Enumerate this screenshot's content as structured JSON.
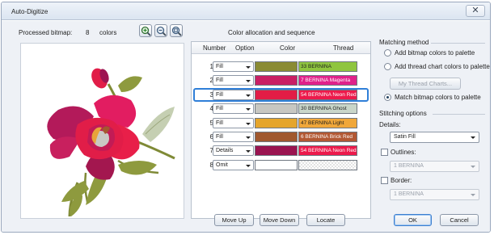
{
  "window": {
    "title": "Auto-Digitize",
    "close_glyph": "✕"
  },
  "bitmap": {
    "label": "Processed bitmap:",
    "count": "8",
    "unit": "colors"
  },
  "zoom_icons": [
    "zoom-in-icon",
    "zoom-out-icon",
    "zoom-fit-icon"
  ],
  "allocation": {
    "title": "Color allocation and sequence",
    "headers": {
      "number": "Number",
      "option": "Option",
      "color": "Color",
      "thread": "Thread"
    },
    "rows": [
      {
        "number": "1",
        "option": "Fill",
        "color": "#8a8b34",
        "thread": "33 BERNINA",
        "thread_color": "#8fc53f",
        "thread_text": "#1e1e1e"
      },
      {
        "number": "2",
        "option": "Fill",
        "color": "#c91f64",
        "thread": "7 BERNINA Magenta",
        "thread_color": "#e0218a",
        "thread_text": "#ffffff"
      },
      {
        "number": "3",
        "option": "Fill",
        "color": "#e21d46",
        "thread": "54 BERNINA Neon Red",
        "thread_color": "#ec1a4b",
        "thread_text": "#ffffff",
        "selected": true
      },
      {
        "number": "4",
        "option": "Fill",
        "color": "#c7c7c2",
        "thread": "30 BERNINA Ghost",
        "thread_color": "#c9d6c9",
        "thread_text": "#1e1e1e"
      },
      {
        "number": "5",
        "option": "Fill",
        "color": "#e5a52b",
        "thread": "47 BERNINA Light",
        "thread_color": "#f0a73a",
        "thread_text": "#1e1e1e"
      },
      {
        "number": "6",
        "option": "Fill",
        "color": "#a0582e",
        "thread": "6 BERNINA Brick Red",
        "thread_color": "#b25833",
        "thread_text": "#ffffff"
      },
      {
        "number": "7",
        "option": "Details",
        "color": "#9a1450",
        "thread": "54 BERNINA Neon Red",
        "thread_color": "#ec1a4b",
        "thread_text": "#ffffff"
      },
      {
        "number": "8",
        "option": "Omit",
        "color": "#ffffff",
        "thread": "",
        "thread_color": "",
        "thread_text": "#1e1e1e",
        "empty": true
      }
    ]
  },
  "matching": {
    "title": "Matching method",
    "options": [
      {
        "label": "Add bitmap colors to palette",
        "checked": false
      },
      {
        "label": "Add thread chart colors to palette",
        "checked": false
      },
      {
        "label": "Match bitmap colors to palette",
        "checked": true
      }
    ],
    "thread_charts_button": "My Thread Charts..."
  },
  "stitching": {
    "title": "Stitching options",
    "details_label": "Details:",
    "details_value": "Satin Fill",
    "outlines_label": "Outlines:",
    "outlines_value": "1 BERNINA",
    "border_label": "Border:",
    "border_value": "1 BERNINA"
  },
  "buttons": {
    "move_up": "Move Up",
    "move_down": "Move Down",
    "locate": "Locate",
    "ok": "OK",
    "cancel": "Cancel"
  }
}
